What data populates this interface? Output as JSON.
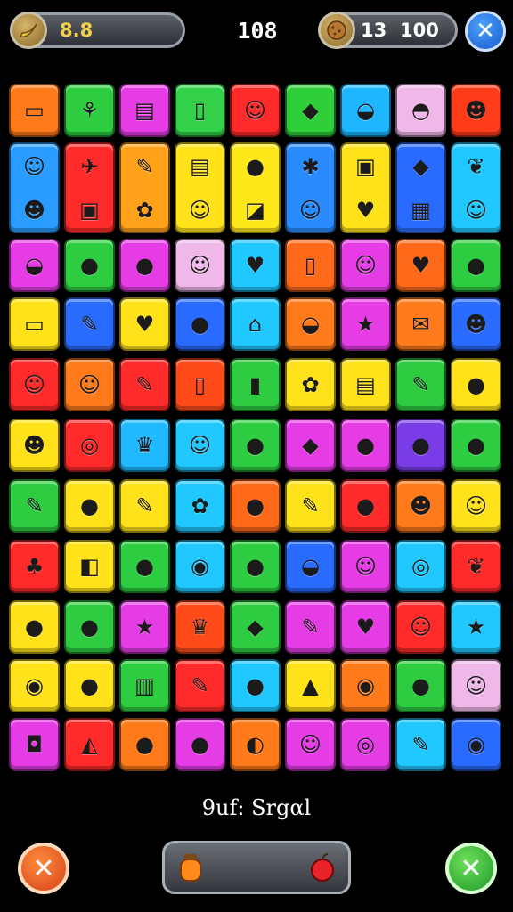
{
  "hud": {
    "left_score": "8.8",
    "left_badge_icon": "banana-icon",
    "center_value": "108",
    "coins": "13",
    "total": "100",
    "right_badge_icon": "cookie-icon",
    "close_symbol": "✕"
  },
  "status_label": "9uf: Srgαl",
  "bottom": {
    "cancel_symbol": "✕",
    "confirm_symbol": "✕",
    "tray_left_icon": "orange-bottle-icon",
    "tray_right_icon": "apple-icon"
  },
  "grid": {
    "rows": 11,
    "cols": 9,
    "tiles": [
      {
        "r": 0,
        "c": 0,
        "color": "#ff7a1a",
        "icon": "card-icon",
        "glyph": "▭"
      },
      {
        "r": 0,
        "c": 1,
        "color": "#2ecc40",
        "icon": "basket-icon",
        "glyph": "⚘"
      },
      {
        "r": 0,
        "c": 2,
        "color": "#e63ce6",
        "icon": "document-icon",
        "glyph": "▤"
      },
      {
        "r": 0,
        "c": 3,
        "color": "#33d14a",
        "icon": "phone-icon",
        "glyph": "▯"
      },
      {
        "r": 0,
        "c": 4,
        "color": "#ff2a2a",
        "icon": "baby-face-icon",
        "glyph": "☺"
      },
      {
        "r": 0,
        "c": 5,
        "color": "#2fcf3a",
        "icon": "sweet-potato-icon",
        "glyph": "◆"
      },
      {
        "r": 0,
        "c": 6,
        "color": "#1eb7ff",
        "icon": "bowl-icon",
        "glyph": "◒"
      },
      {
        "r": 0,
        "c": 7,
        "color": "#f0b8e8",
        "icon": "pokeball-icon",
        "glyph": "◓"
      },
      {
        "r": 0,
        "c": 8,
        "color": "#ff3b1a",
        "icon": "cowboy-face-icon",
        "glyph": "☻"
      },
      {
        "r": 1,
        "c": 0,
        "color": "#2a9bff",
        "icon": "smiley-icon",
        "glyph": "☺",
        "tall": true,
        "glyph2": "☻",
        "icon2": "alien-face-icon"
      },
      {
        "r": 1,
        "c": 1,
        "color": "#ff2a2a",
        "icon": "paper-plane-icon",
        "glyph": "✈",
        "tall": true,
        "glyph2": "▣",
        "icon2": "robot-icon"
      },
      {
        "r": 1,
        "c": 2,
        "color": "#ffa21a",
        "icon": "crayon-icon",
        "glyph": "✎",
        "tall": true,
        "glyph2": "✿",
        "icon2": "turtle-icon"
      },
      {
        "r": 1,
        "c": 3,
        "color": "#ffe21a",
        "icon": "book-icon",
        "glyph": "▤",
        "tall": true,
        "glyph2": "☺",
        "icon2": "kid-face-icon"
      },
      {
        "r": 1,
        "c": 4,
        "color": "#ffe81a",
        "icon": "balloon-icon",
        "glyph": "●",
        "tall": true,
        "glyph2": "◪",
        "icon2": "playing-card-icon"
      },
      {
        "r": 1,
        "c": 5,
        "color": "#2a8bff",
        "icon": "badge-icon",
        "glyph": "✱",
        "tall": true,
        "glyph2": "☺",
        "icon2": "teddy-icon"
      },
      {
        "r": 1,
        "c": 6,
        "color": "#ffe21a",
        "icon": "scoreboard-icon",
        "glyph": "▣",
        "tall": true,
        "glyph2": "♥",
        "icon2": "shield-icon"
      },
      {
        "r": 1,
        "c": 7,
        "color": "#2a6bff",
        "icon": "diamond-sign-icon",
        "glyph": "◆",
        "tall": true,
        "glyph2": "▦",
        "icon2": "board-game-icon"
      },
      {
        "r": 1,
        "c": 8,
        "color": "#20c8ff",
        "icon": "leaf-icon",
        "glyph": "❦",
        "tall": true,
        "glyph2": "☺",
        "icon2": "yellow-face-icon"
      },
      {
        "r": 2,
        "c": 0,
        "color": "#e63ce6",
        "icon": "burger-icon",
        "glyph": "◒"
      },
      {
        "r": 2,
        "c": 1,
        "color": "#2ecc40",
        "icon": "apple-icon",
        "glyph": "●"
      },
      {
        "r": 2,
        "c": 2,
        "color": "#e63ce6",
        "icon": "orange-icon",
        "glyph": "●"
      },
      {
        "r": 2,
        "c": 3,
        "color": "#f0b8e8",
        "icon": "green-face-icon",
        "glyph": "☺"
      },
      {
        "r": 2,
        "c": 4,
        "color": "#20c8ff",
        "icon": "heart-icon",
        "glyph": "♥"
      },
      {
        "r": 2,
        "c": 5,
        "color": "#ff6a1a",
        "icon": "jar-icon",
        "glyph": "▯"
      },
      {
        "r": 2,
        "c": 6,
        "color": "#e63ce6",
        "icon": "zombie-face-icon",
        "glyph": "☺"
      },
      {
        "r": 2,
        "c": 7,
        "color": "#ff6a1a",
        "icon": "heart-icon",
        "glyph": "♥"
      },
      {
        "r": 2,
        "c": 8,
        "color": "#2ecc40",
        "icon": "strawberry-icon",
        "glyph": "●"
      },
      {
        "r": 3,
        "c": 0,
        "color": "#ffe21a",
        "icon": "tablet-icon",
        "glyph": "▭"
      },
      {
        "r": 3,
        "c": 1,
        "color": "#2a6bff",
        "icon": "crayon-icon",
        "glyph": "✎"
      },
      {
        "r": 3,
        "c": 2,
        "color": "#ffe21a",
        "icon": "heart-icon",
        "glyph": "♥"
      },
      {
        "r": 3,
        "c": 3,
        "color": "#2a6bff",
        "icon": "beet-icon",
        "glyph": "●"
      },
      {
        "r": 3,
        "c": 4,
        "color": "#20c8ff",
        "icon": "house-icon",
        "glyph": "⌂"
      },
      {
        "r": 3,
        "c": 5,
        "color": "#ff7a1a",
        "icon": "macaron-icon",
        "glyph": "◒"
      },
      {
        "r": 3,
        "c": 6,
        "color": "#e63ce6",
        "icon": "star-icon",
        "glyph": "★"
      },
      {
        "r": 3,
        "c": 7,
        "color": "#ff7a1a",
        "icon": "envelope-icon",
        "glyph": "✉"
      },
      {
        "r": 3,
        "c": 8,
        "color": "#2a6bff",
        "icon": "monkey-icon",
        "glyph": "☻"
      },
      {
        "r": 4,
        "c": 0,
        "color": "#ff2a2a",
        "icon": "smiley-icon",
        "glyph": "☺"
      },
      {
        "r": 4,
        "c": 1,
        "color": "#ff7a1a",
        "icon": "baby-face-icon",
        "glyph": "☺"
      },
      {
        "r": 4,
        "c": 2,
        "color": "#ff2a2a",
        "icon": "popsicle-icon",
        "glyph": "✎"
      },
      {
        "r": 4,
        "c": 3,
        "color": "#ff4a1a",
        "icon": "can-icon",
        "glyph": "▯"
      },
      {
        "r": 4,
        "c": 4,
        "color": "#2ecc40",
        "icon": "tube-icon",
        "glyph": "▮"
      },
      {
        "r": 4,
        "c": 5,
        "color": "#ffe21a",
        "icon": "lion-icon",
        "glyph": "✿"
      },
      {
        "r": 4,
        "c": 6,
        "color": "#ffe21a",
        "icon": "notepad-icon",
        "glyph": "▤"
      },
      {
        "r": 4,
        "c": 7,
        "color": "#2ecc40",
        "icon": "pencil-icon",
        "glyph": "✎"
      },
      {
        "r": 4,
        "c": 8,
        "color": "#ffe21a",
        "icon": "blueberry-icon",
        "glyph": "●"
      },
      {
        "r": 5,
        "c": 0,
        "color": "#ffe21a",
        "icon": "skull-icon",
        "glyph": "☻"
      },
      {
        "r": 5,
        "c": 1,
        "color": "#ff2a2a",
        "icon": "spiral-icon",
        "glyph": "◎"
      },
      {
        "r": 5,
        "c": 2,
        "color": "#20b8ff",
        "icon": "crown-icon",
        "glyph": "♛"
      },
      {
        "r": 5,
        "c": 3,
        "color": "#20c8ff",
        "icon": "pink-face-icon",
        "glyph": "☺"
      },
      {
        "r": 5,
        "c": 4,
        "color": "#2ecc40",
        "icon": "strawberry-icon",
        "glyph": "●"
      },
      {
        "r": 5,
        "c": 5,
        "color": "#e63ce6",
        "icon": "gem-icon",
        "glyph": "◆"
      },
      {
        "r": 5,
        "c": 6,
        "color": "#e63ce6",
        "icon": "lime-icon",
        "glyph": "●"
      },
      {
        "r": 5,
        "c": 7,
        "color": "#7a3ce6",
        "icon": "green-blob-icon",
        "glyph": "●"
      },
      {
        "r": 5,
        "c": 8,
        "color": "#2ecc40",
        "icon": "radish-icon",
        "glyph": "●"
      },
      {
        "r": 6,
        "c": 0,
        "color": "#2ecc40",
        "icon": "glue-icon",
        "glyph": "✎"
      },
      {
        "r": 6,
        "c": 1,
        "color": "#ffe21a",
        "icon": "orange-icon",
        "glyph": "●"
      },
      {
        "r": 6,
        "c": 2,
        "color": "#ffe21a",
        "icon": "marker-icon",
        "glyph": "✎"
      },
      {
        "r": 6,
        "c": 3,
        "color": "#20c8ff",
        "icon": "fruit-bowl-icon",
        "glyph": "✿"
      },
      {
        "r": 6,
        "c": 4,
        "color": "#ff6a1a",
        "icon": "pumpkin-icon",
        "glyph": "●"
      },
      {
        "r": 6,
        "c": 5,
        "color": "#ffe21a",
        "icon": "eraser-icon",
        "glyph": "✎"
      },
      {
        "r": 6,
        "c": 6,
        "color": "#ff2a2a",
        "icon": "plum-icon",
        "glyph": "●"
      },
      {
        "r": 6,
        "c": 7,
        "color": "#ff7a1a",
        "icon": "berry-face-icon",
        "glyph": "☻"
      },
      {
        "r": 6,
        "c": 8,
        "color": "#ffe21a",
        "icon": "white-face-icon",
        "glyph": "☺"
      },
      {
        "r": 7,
        "c": 0,
        "color": "#ff2a2a",
        "icon": "cactus-icon",
        "glyph": "♣"
      },
      {
        "r": 7,
        "c": 1,
        "color": "#ffe21a",
        "icon": "ticket-icon",
        "glyph": "◧"
      },
      {
        "r": 7,
        "c": 2,
        "color": "#2ecc40",
        "icon": "plum-icon",
        "glyph": "●"
      },
      {
        "r": 7,
        "c": 3,
        "color": "#20c8ff",
        "icon": "flame-icon",
        "glyph": "◉"
      },
      {
        "r": 7,
        "c": 4,
        "color": "#2ecc40",
        "icon": "mango-icon",
        "glyph": "●"
      },
      {
        "r": 7,
        "c": 5,
        "color": "#2a6bff",
        "icon": "burger-icon",
        "glyph": "◒"
      },
      {
        "r": 7,
        "c": 6,
        "color": "#e63ce6",
        "icon": "ghost-icon",
        "glyph": "☺"
      },
      {
        "r": 7,
        "c": 7,
        "color": "#20c8ff",
        "icon": "donut-icon",
        "glyph": "◎"
      },
      {
        "r": 7,
        "c": 8,
        "color": "#ff2a2a",
        "icon": "leaf-icon",
        "glyph": "❦"
      },
      {
        "r": 8,
        "c": 0,
        "color": "#ffe21a",
        "icon": "eggplant-icon",
        "glyph": "●"
      },
      {
        "r": 8,
        "c": 1,
        "color": "#2ecc40",
        "icon": "apple-icon",
        "glyph": "●"
      },
      {
        "r": 8,
        "c": 2,
        "color": "#e63ce6",
        "icon": "star-icon",
        "glyph": "★"
      },
      {
        "r": 8,
        "c": 3,
        "color": "#ff4a1a",
        "icon": "crown-icon",
        "glyph": "♛"
      },
      {
        "r": 8,
        "c": 4,
        "color": "#2ecc40",
        "icon": "gem-icon",
        "glyph": "◆"
      },
      {
        "r": 8,
        "c": 5,
        "color": "#e63ce6",
        "icon": "pencil-icon",
        "glyph": "✎"
      },
      {
        "r": 8,
        "c": 6,
        "color": "#e63ce6",
        "icon": "heart-icon",
        "glyph": "♥"
      },
      {
        "r": 8,
        "c": 7,
        "color": "#ff2a2a",
        "icon": "yellow-face-icon",
        "glyph": "☺"
      },
      {
        "r": 8,
        "c": 8,
        "color": "#20c8ff",
        "icon": "star-icon",
        "glyph": "★"
      },
      {
        "r": 9,
        "c": 0,
        "color": "#ffe21a",
        "icon": "blue-bottle-icon",
        "glyph": "◉"
      },
      {
        "r": 9,
        "c": 1,
        "color": "#ffe21a",
        "icon": "strawberry-icon",
        "glyph": "●"
      },
      {
        "r": 9,
        "c": 2,
        "color": "#2ecc40",
        "icon": "barcode-icon",
        "glyph": "▥"
      },
      {
        "r": 9,
        "c": 3,
        "color": "#ff2a2a",
        "icon": "syringe-icon",
        "glyph": "✎"
      },
      {
        "r": 9,
        "c": 4,
        "color": "#20c8ff",
        "icon": "lemon-icon",
        "glyph": "●"
      },
      {
        "r": 9,
        "c": 5,
        "color": "#ffe21a",
        "icon": "poop-icon",
        "glyph": "▲"
      },
      {
        "r": 9,
        "c": 6,
        "color": "#ff7a1a",
        "icon": "red-berry-icon",
        "glyph": "◉"
      },
      {
        "r": 9,
        "c": 7,
        "color": "#2ecc40",
        "icon": "plum-icon",
        "glyph": "●"
      },
      {
        "r": 9,
        "c": 8,
        "color": "#f0b8e8",
        "icon": "green-face-icon",
        "glyph": "☺"
      },
      {
        "r": 10,
        "c": 0,
        "color": "#e63ce6",
        "icon": "drum-icon",
        "glyph": "◘"
      },
      {
        "r": 10,
        "c": 1,
        "color": "#ff2a2a",
        "icon": "cheese-icon",
        "glyph": "◭"
      },
      {
        "r": 10,
        "c": 2,
        "color": "#ff7a1a",
        "icon": "lime-icon",
        "glyph": "●"
      },
      {
        "r": 10,
        "c": 3,
        "color": "#e63ce6",
        "icon": "mango-icon",
        "glyph": "●"
      },
      {
        "r": 10,
        "c": 4,
        "color": "#ff7a1a",
        "icon": "shell-icon",
        "glyph": "◐"
      },
      {
        "r": 10,
        "c": 5,
        "color": "#e63ce6",
        "icon": "teal-face-icon",
        "glyph": "☺"
      },
      {
        "r": 10,
        "c": 6,
        "color": "#e63ce6",
        "icon": "donut-icon",
        "glyph": "◎"
      },
      {
        "r": 10,
        "c": 7,
        "color": "#20c8ff",
        "icon": "popsicle-icon",
        "glyph": "✎"
      },
      {
        "r": 10,
        "c": 8,
        "color": "#2a6bff",
        "icon": "pizza-icon",
        "glyph": "◉"
      }
    ]
  }
}
